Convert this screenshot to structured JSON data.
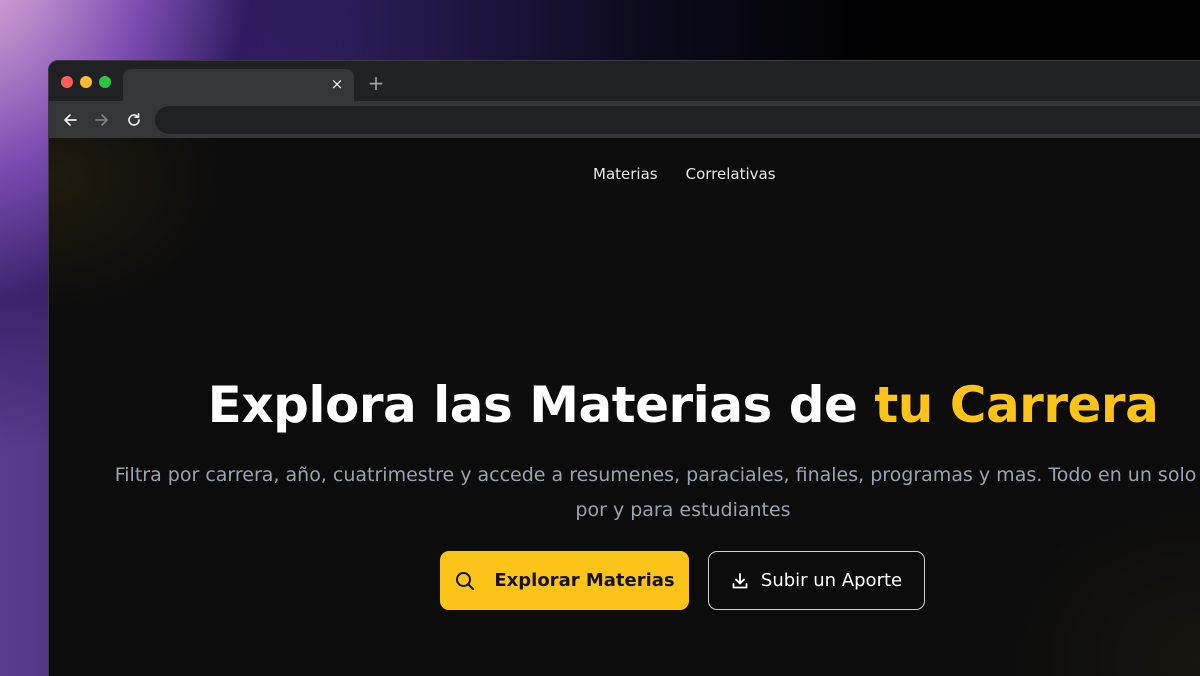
{
  "browser": {
    "tab_close": "×",
    "new_tab": "+",
    "icons": {
      "back": "arrow-left-icon",
      "forward": "arrow-right-icon",
      "reload": "reload-icon"
    }
  },
  "nav": {
    "items": [
      {
        "label": "Materias"
      },
      {
        "label": "Correlativas"
      }
    ]
  },
  "hero": {
    "title_main": "Explora las Materias de ",
    "title_accent": "tu Carrera",
    "subtitle_line1": "Filtra por carrera, año, cuatrimestre y accede a resumenes, paraciales, finales, programas y mas. Todo en un solo lugar",
    "subtitle_line2": "por y para estudiantes",
    "primary_button": "Explorar Materias",
    "secondary_button": "Subir un Aporte"
  },
  "colors": {
    "accent": "#fcc419",
    "page_bg": "#0c0c0d",
    "subtitle": "#9aa3b2"
  }
}
